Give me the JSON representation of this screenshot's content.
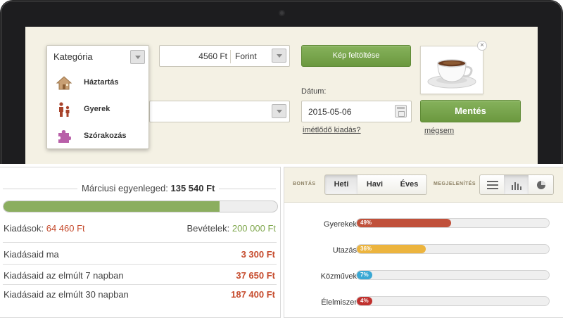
{
  "form": {
    "amount_value": "4560 Ft",
    "currency": "Forint",
    "upload_label": "Kép feltöltése",
    "date_label": "Dátum:",
    "date_value": "2015-05-06",
    "recurring_link": "imétlődő kiadás?",
    "save_label": "Mentés",
    "cancel_link": "mégsem",
    "photo_close": "×"
  },
  "category_dropdown": {
    "header": "Kategória",
    "items": [
      {
        "label": "Háztartás",
        "icon": "house-icon"
      },
      {
        "label": "Gyerek",
        "icon": "family-icon"
      },
      {
        "label": "Szórakozás",
        "icon": "puzzle-icon"
      }
    ]
  },
  "balance": {
    "label": "Márciusi egyenleged:",
    "value": "135 540 Ft",
    "progress_fraction": 0.79,
    "expenses_label": "Kiadások:",
    "expenses_value": "64 460 Ft",
    "income_label": "Bevételek:",
    "income_value": "200 000 Ft",
    "rows": [
      {
        "label": "Kiadásaid ma",
        "value": "3 300 Ft"
      },
      {
        "label": "Kiadásaid az elmúlt 7 napban",
        "value": "37 650 Ft"
      },
      {
        "label": "Kiadásaid az elmúlt 30 napban",
        "value": "187 400 Ft"
      }
    ]
  },
  "breakdown": {
    "label_split": "BONTÁS",
    "tabs": [
      "Heti",
      "Havi",
      "Éves"
    ],
    "active_tab": "Heti",
    "label_view": "MEGJELENÍTÉS",
    "views": [
      "list-icon",
      "bar-chart-icon",
      "pie-chart-icon"
    ],
    "active_view": "bar-chart-icon"
  },
  "colors": {
    "green": "#7ea64b",
    "red": "#c64b2d",
    "bar_red": "#c0503a",
    "bar_yellow": "#ecb43e",
    "bar_blue": "#3aa8d4",
    "bar_darkred": "#c0312e"
  },
  "chart_data": {
    "type": "bar",
    "categories": [
      "Gyerekek",
      "Utazás",
      "Közművek",
      "Élelmiszer"
    ],
    "values": [
      49,
      36,
      7,
      4
    ],
    "value_labels": [
      "49%",
      "36%",
      "7%",
      "4%"
    ],
    "ylim": [
      0,
      100
    ],
    "orientation": "horizontal"
  }
}
